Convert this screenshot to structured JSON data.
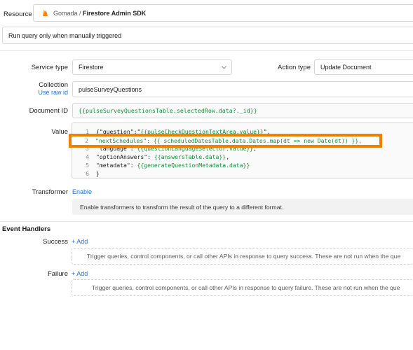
{
  "resource": {
    "label": "Resource",
    "workspace": "Gomada",
    "separator": " / ",
    "name": "Firestore Admin SDK",
    "icon": "firebase-icon"
  },
  "trigger_mode": {
    "value": "Run query only when manually triggered"
  },
  "service_type": {
    "label": "Service type",
    "value": "Firestore"
  },
  "action_type": {
    "label": "Action type",
    "value": "Update Document"
  },
  "collection": {
    "label": "Collection",
    "link": "Use raw id",
    "value": "pulseSurveyQuestions"
  },
  "document_id": {
    "label": "Document ID",
    "value": "{{pulseSurveyQuestionsTable.selectedRow.data?._id}}"
  },
  "value_editor": {
    "label": "Value",
    "lines": [
      {
        "n": "1",
        "text": "{\"question\":\"{{pulseCheckQuestionTextArea.value}}\","
      },
      {
        "n": "2",
        "text": "\"nextSchedules\": {{ scheduledDatesTable.data.Dates.map(dt => new Date(dt)) }},"
      },
      {
        "n": "3",
        "text": "\"language\": {{questionLanguageSelector.value}},"
      },
      {
        "n": "4",
        "text": "\"optionAnswers\": {{answersTable.data}},"
      },
      {
        "n": "5",
        "text": "\"metadata\": {{generateQuestionMetadata.data}}"
      },
      {
        "n": "6",
        "text": "}"
      }
    ],
    "highlight_color": "#f08000"
  },
  "transformer": {
    "label": "Transformer",
    "link": "Enable",
    "info": "Enable transformers to transform the result of the query to a different format."
  },
  "event_handlers": {
    "title": "Event Handlers",
    "success": {
      "label": "Success",
      "add": "+ Add",
      "hint": "Trigger queries, control components, or call other APIs in response to query success. These are not run when the que"
    },
    "failure": {
      "label": "Failure",
      "add": "+ Add",
      "hint": "Trigger queries, control components, or call other APIs in response to query failure. These are not run when the que"
    }
  },
  "colors": {
    "accent": "#1f73d1",
    "template_green": "#138d33",
    "highlight_orange": "#f08000"
  }
}
